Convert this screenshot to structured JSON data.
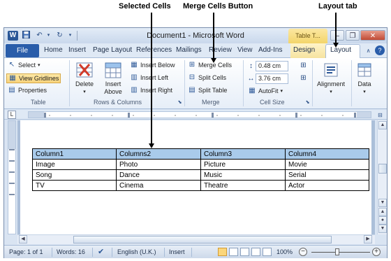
{
  "annotations": {
    "selected_cells": "Selected Cells",
    "merge_cells_button": "Merge Cells Button",
    "layout_tab": "Layout tab"
  },
  "titlebar": {
    "app_icon": "W",
    "title": "Document1 - Microsoft Word",
    "contextual_tab": "Table T...",
    "undo_icon": "undo-icon",
    "redo_icon": "redo-icon",
    "save_icon": "save-icon"
  },
  "tabs": {
    "file": "File",
    "items": [
      "Home",
      "Insert",
      "Page Layout",
      "References",
      "Mailings",
      "Review",
      "View",
      "Add-Ins",
      "Design",
      "Layout"
    ],
    "active": "Layout"
  },
  "ribbon": {
    "table_group": {
      "label": "Table",
      "select": "Select",
      "view_gridlines": "View Gridlines",
      "properties": "Properties"
    },
    "rows_columns_group": {
      "label": "Rows & Columns",
      "delete": "Delete",
      "insert_above_1": "Insert",
      "insert_above_2": "Above",
      "insert_below": "Insert Below",
      "insert_left": "Insert Left",
      "insert_right": "Insert Right"
    },
    "merge_group": {
      "label": "Merge",
      "merge_cells": "Merge Cells",
      "split_cells": "Split Cells",
      "split_table": "Split Table"
    },
    "cell_size_group": {
      "label": "Cell Size",
      "height": "0.48 cm",
      "width": "3.76 cm",
      "autofit": "AutoFit"
    },
    "alignment": "Alignment",
    "data": "Data"
  },
  "document": {
    "table": {
      "header": [
        "Column1",
        "Columns2",
        "Column3",
        "Column4"
      ],
      "rows": [
        [
          "Image",
          "Photo",
          "Picture",
          "Movie"
        ],
        [
          "Song",
          "Dance",
          "Music",
          "Serial"
        ],
        [
          "TV",
          "Cinema",
          "Theatre",
          "Actor"
        ]
      ]
    }
  },
  "statusbar": {
    "page": "Page: 1 of 1",
    "words": "Words: 16",
    "language": "English (U.K.)",
    "mode": "Insert",
    "zoom": "100%"
  },
  "colors": {
    "selection": "#a9cbeb",
    "file_tab": "#2a5daa",
    "contextual_tab": "#f3d56a"
  }
}
